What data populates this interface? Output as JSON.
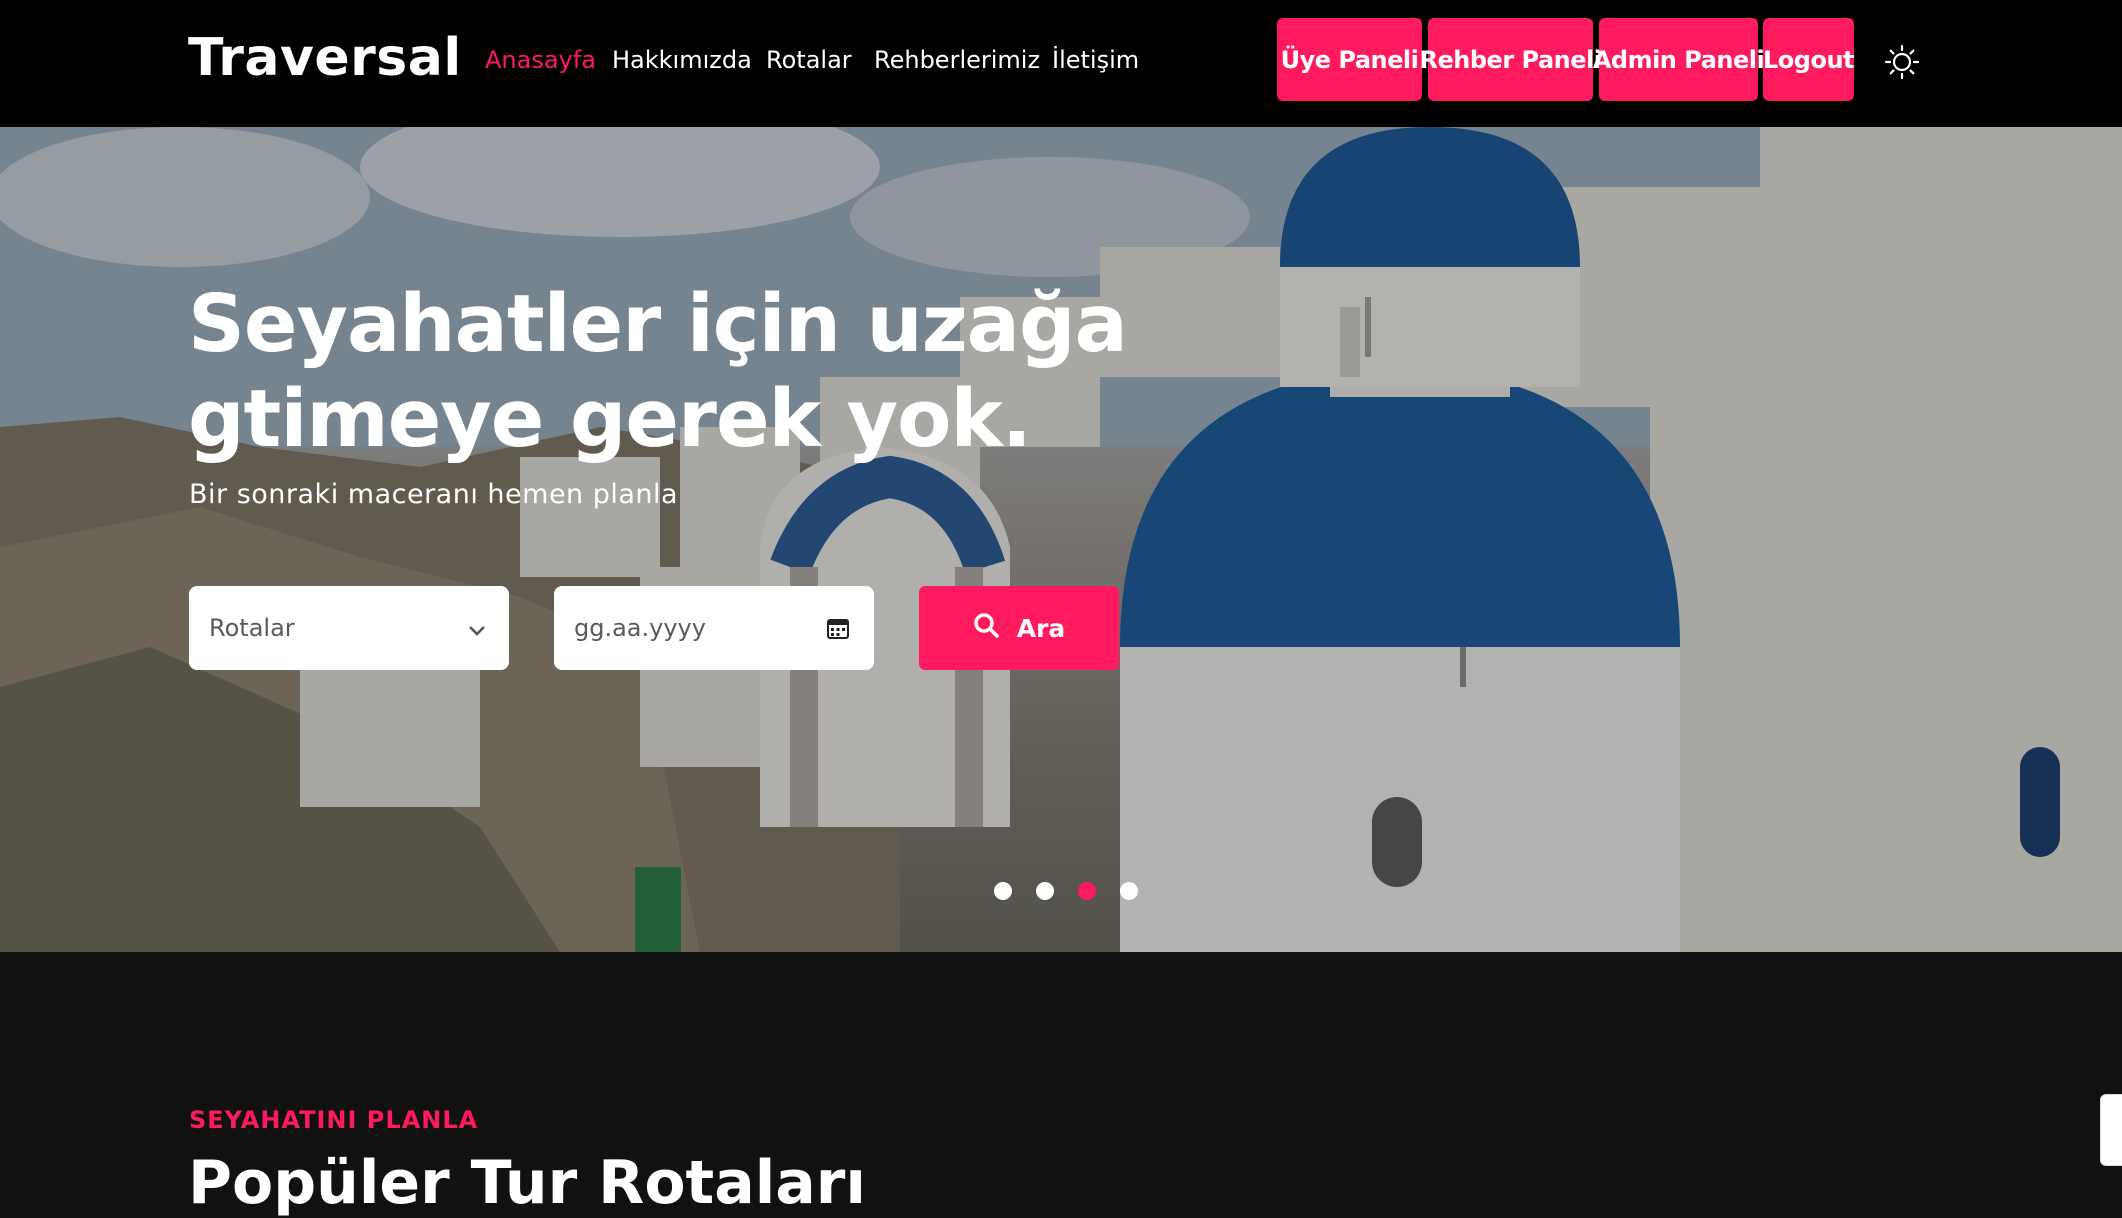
{
  "brand": {
    "name": "Traversal",
    "accent": "#ff1a5e"
  },
  "nav": {
    "items": [
      {
        "label": "Anasayfa",
        "active": true
      },
      {
        "label": "Hakkımızda"
      },
      {
        "label": "Rotalar"
      },
      {
        "label": "Rehberlerimiz"
      },
      {
        "label": "İletişim"
      }
    ]
  },
  "panels": [
    {
      "label": "Üye Paneli"
    },
    {
      "label": "Rehber Paneli"
    },
    {
      "label": "Admin Paneli"
    },
    {
      "label": "Logout"
    }
  ],
  "theme_toggle": {
    "icon": "sun-icon"
  },
  "hero": {
    "title": "Seyahatler için uzağa gtimeye gerek yok.",
    "subtitle": "Bir sonraki maceranı hemen planla",
    "route_select": {
      "value": "Rotalar",
      "icon": "chevron-down-icon"
    },
    "date_input": {
      "placeholder": "gg.aa.yyyy",
      "icon": "calendar-icon"
    },
    "search_button": {
      "label": "Ara",
      "icon": "search-icon"
    },
    "carousel": {
      "count": 4,
      "active_index": 2
    }
  },
  "section": {
    "kicker": "SEYAHATINI PLANLA",
    "title": "Popüler Tur Rotaları"
  }
}
